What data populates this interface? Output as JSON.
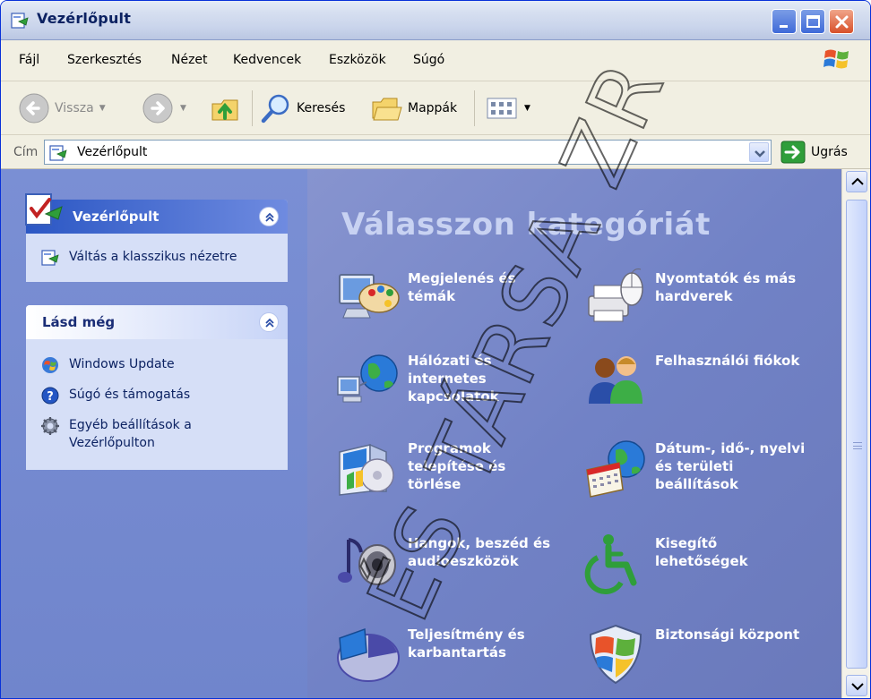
{
  "window": {
    "title": "Vezérlőpult"
  },
  "menu": {
    "items": [
      "Fájl",
      "Szerkesztés",
      "Nézet",
      "Kedvencek",
      "Eszközök",
      "Súgó"
    ]
  },
  "toolbar": {
    "back_label": "Vissza",
    "search_label": "Keresés",
    "folders_label": "Mappák"
  },
  "address": {
    "label": "Cím",
    "value": "Vezérlőpult",
    "go_label": "Ugrás"
  },
  "taskpane": {
    "control_panel": {
      "title": "Vezérlőpult",
      "links": [
        {
          "label": "Váltás a klasszikus nézetre",
          "icon": "control-panel-icon"
        }
      ]
    },
    "see_also": {
      "title": "Lásd még",
      "links": [
        {
          "label": "Windows Update",
          "icon": "windows-update-icon"
        },
        {
          "label": "Súgó és támogatás",
          "icon": "help-icon"
        },
        {
          "label": "Egyéb beállítások a Vezérlőpulton",
          "icon": "gear-icon"
        }
      ]
    }
  },
  "categories": {
    "heading": "Válasszon kategóriát",
    "items": [
      {
        "label": "Megjelenés és témák",
        "icon": "appearance-icon"
      },
      {
        "label": "Nyomtatók és más hardverek",
        "icon": "printer-icon"
      },
      {
        "label": "Hálózati és internetes kapcsolatok",
        "icon": "network-icon"
      },
      {
        "label": "Felhasználói fiókok",
        "icon": "user-accounts-icon"
      },
      {
        "label": "Programok telepítése és törlése",
        "icon": "add-remove-programs-icon"
      },
      {
        "label": "Dátum-, idő-, nyelvi és területi beállítások",
        "icon": "date-time-icon"
      },
      {
        "label": "Hangok, beszéd és audioeszközök",
        "icon": "sound-icon"
      },
      {
        "label": "Kisegítő lehetőségek",
        "icon": "accessibility-icon"
      },
      {
        "label": "Teljesítmény és karbantartás",
        "icon": "performance-icon"
      },
      {
        "label": "Biztonsági központ",
        "icon": "security-center-icon"
      }
    ]
  },
  "watermark": {
    "text": "ÉS TÁRSA ZR"
  },
  "colors": {
    "title_text": "#0c2262",
    "category_background": "#7182c6",
    "heading_text": "#c8d2f2"
  }
}
